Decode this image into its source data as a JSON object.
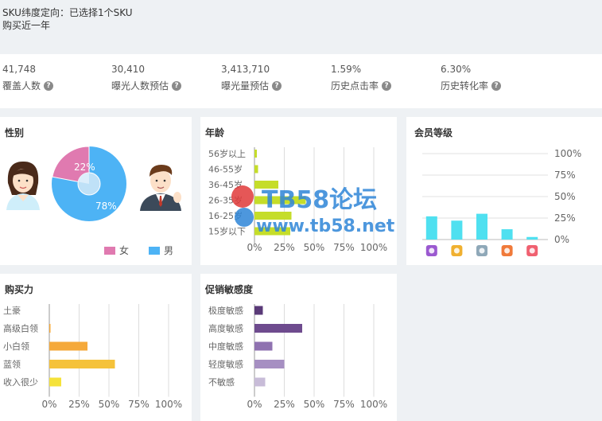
{
  "header": {
    "line1": "SKU纬度定向：已选择1个SKU",
    "line2": "购买近一年"
  },
  "stats": [
    {
      "value": "41,748",
      "label": "覆盖人数"
    },
    {
      "value": "30,410",
      "label": "曝光人数预估"
    },
    {
      "value": "3,413,710",
      "label": "曝光量预估"
    },
    {
      "value": "1.59%",
      "label": "历史点击率"
    },
    {
      "value": "6.30%",
      "label": "历史转化率"
    }
  ],
  "help_icon": "?",
  "gender": {
    "title": "性别",
    "female_pct_label": "22%",
    "male_pct_label": "78%",
    "female_fraction": 0.22,
    "legend": [
      "女",
      "男"
    ],
    "colors": {
      "female": "#e07ab0",
      "male": "#4db3f5"
    }
  },
  "age": {
    "title": "年龄",
    "categories": [
      "56岁以上",
      "46-55岁",
      "36-45岁",
      "26-35岁",
      "16-25岁",
      "15岁以下"
    ],
    "values": [
      2,
      3,
      20,
      43,
      31,
      30
    ],
    "ticks": [
      "0%",
      "25%",
      "50%",
      "75%",
      "100%"
    ],
    "color": "#c5dd2a"
  },
  "member": {
    "title": "会员等级",
    "values": [
      27,
      22,
      30,
      12,
      3
    ],
    "ticks": [
      "100%",
      "75%",
      "50%",
      "25%",
      "0%"
    ],
    "color": "#4fe0f0",
    "icon_names": [
      "diamond-member-icon",
      "gold-member-icon",
      "silver-member-icon",
      "bronze-member-icon",
      "registered-member-icon"
    ],
    "icon_colors": [
      "#9b59d0",
      "#f0b030",
      "#8fa8b8",
      "#f07a3a",
      "#f06070"
    ]
  },
  "purchase": {
    "title": "购买力",
    "categories": [
      "土豪",
      "高级白领",
      "小白领",
      "蓝领",
      "收入很少"
    ],
    "values": [
      0,
      1,
      32,
      55,
      10
    ],
    "colors": [
      "#f5a93a",
      "#f5a93a",
      "#f5a93a",
      "#f5c23a",
      "#f5e23a"
    ],
    "ticks": [
      "0%",
      "25%",
      "50%",
      "75%",
      "100%"
    ]
  },
  "promo": {
    "title": "促销敏感度",
    "categories": [
      "极度敏感",
      "高度敏感",
      "中度敏感",
      "轻度敏感",
      "不敏感"
    ],
    "values": [
      7,
      40,
      15,
      25,
      9
    ],
    "colors": [
      "#5a3a78",
      "#6e4b8e",
      "#8f72b0",
      "#a68fc2",
      "#c8bcd8"
    ],
    "ticks": [
      "0%",
      "25%",
      "50%",
      "75%",
      "100%"
    ]
  },
  "watermark": {
    "line1": "TB58论坛",
    "line2": "www.tb58.net"
  }
}
